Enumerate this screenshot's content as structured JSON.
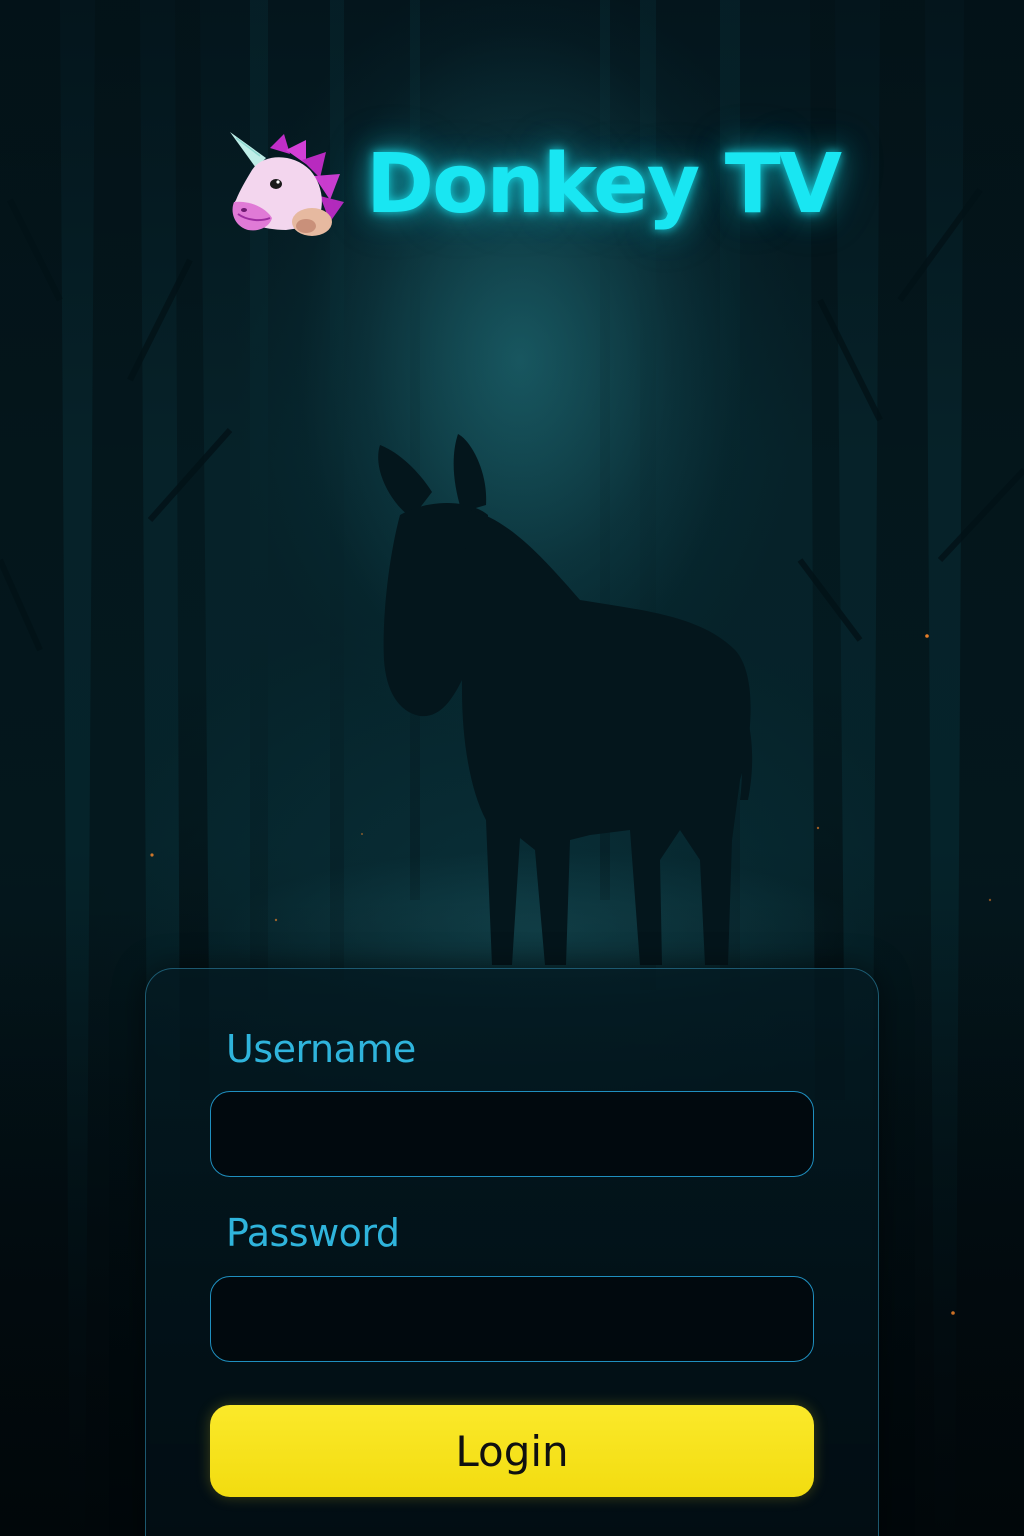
{
  "app": {
    "title": "Donkey TV",
    "logo_icon": "unicorn-icon"
  },
  "background": {
    "subject": "donkey-silhouette",
    "setting": "dark-forest"
  },
  "login_form": {
    "username_label": "Username",
    "username_value": "",
    "password_label": "Password",
    "password_value": "",
    "login_button_label": "Login"
  },
  "colors": {
    "accent": "#19e6f2",
    "label": "#2fb4dc",
    "input_border": "#1f8fbf",
    "button": "#f5e01a",
    "button_text": "#101010"
  }
}
